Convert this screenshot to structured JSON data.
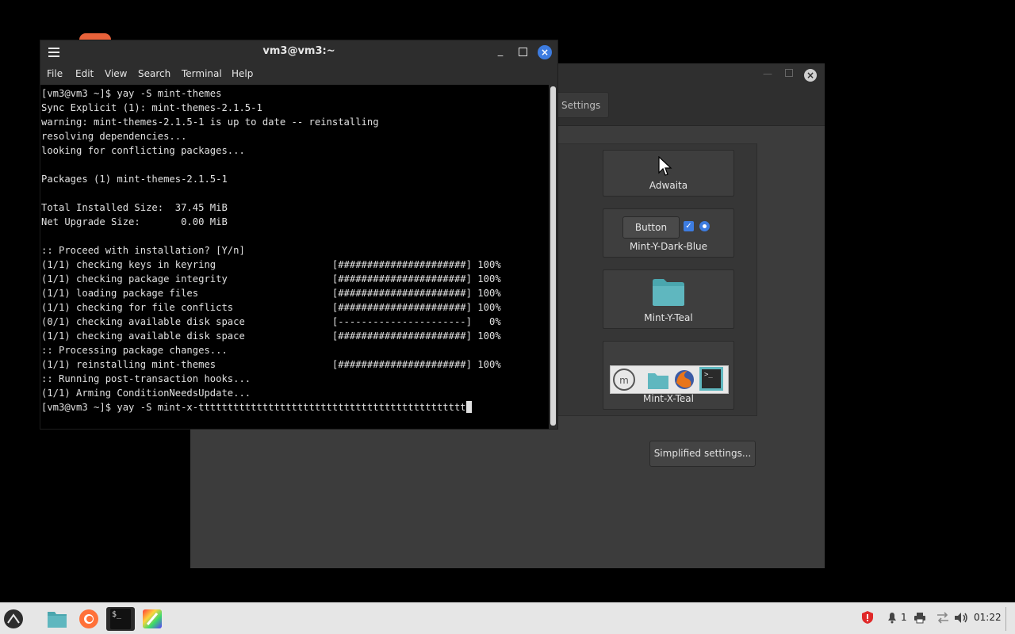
{
  "terminal": {
    "title": "vm3@vm3:~",
    "menu": [
      "File",
      "Edit",
      "View",
      "Search",
      "Terminal",
      "Help"
    ],
    "lines": [
      "[vm3@vm3 ~]$ yay -S mint-themes",
      "Sync Explicit (1): mint-themes-2.1.5-1",
      "warning: mint-themes-2.1.5-1 is up to date -- reinstalling",
      "resolving dependencies...",
      "looking for conflicting packages...",
      "",
      "Packages (1) mint-themes-2.1.5-1",
      "",
      "Total Installed Size:  37.45 MiB",
      "Net Upgrade Size:       0.00 MiB",
      "",
      ":: Proceed with installation? [Y/n]",
      "(1/1) checking keys in keyring                    [######################] 100%",
      "(1/1) checking package integrity                  [######################] 100%",
      "(1/1) loading package files                       [######################] 100%",
      "(1/1) checking for file conflicts                 [######################] 100%",
      "(0/1) checking available disk space               [----------------------]   0%",
      "(1/1) checking available disk space               [######################] 100%",
      ":: Processing package changes...",
      "(1/1) reinstalling mint-themes                    [######################] 100%",
      ":: Running post-transaction hooks...",
      "(1/1) Arming ConditionNeedsUpdate...",
      "[vm3@vm3 ~]$ yay -S mint-x-tttttttttttttttttttttttttttttttttttttttttttttt"
    ]
  },
  "themes_window": {
    "settings_tab": "Settings",
    "cards": [
      {
        "label": "Adwaita"
      },
      {
        "label": "Mint-Y-Dark-Blue",
        "button_label": "Button"
      },
      {
        "label": "Mint-Y-Teal"
      },
      {
        "label": "Mint-X-Teal"
      }
    ],
    "simplified_button": "Simplified settings..."
  },
  "taskbar": {
    "apps": [
      "menu-icon",
      "files-icon",
      "firefox-icon",
      "terminal-icon",
      "color-picker-icon"
    ],
    "notification_count": "1",
    "clock": "01:22"
  },
  "colors": {
    "accent": "#3d7ce0",
    "folder_teal": "#5fb7bf"
  }
}
